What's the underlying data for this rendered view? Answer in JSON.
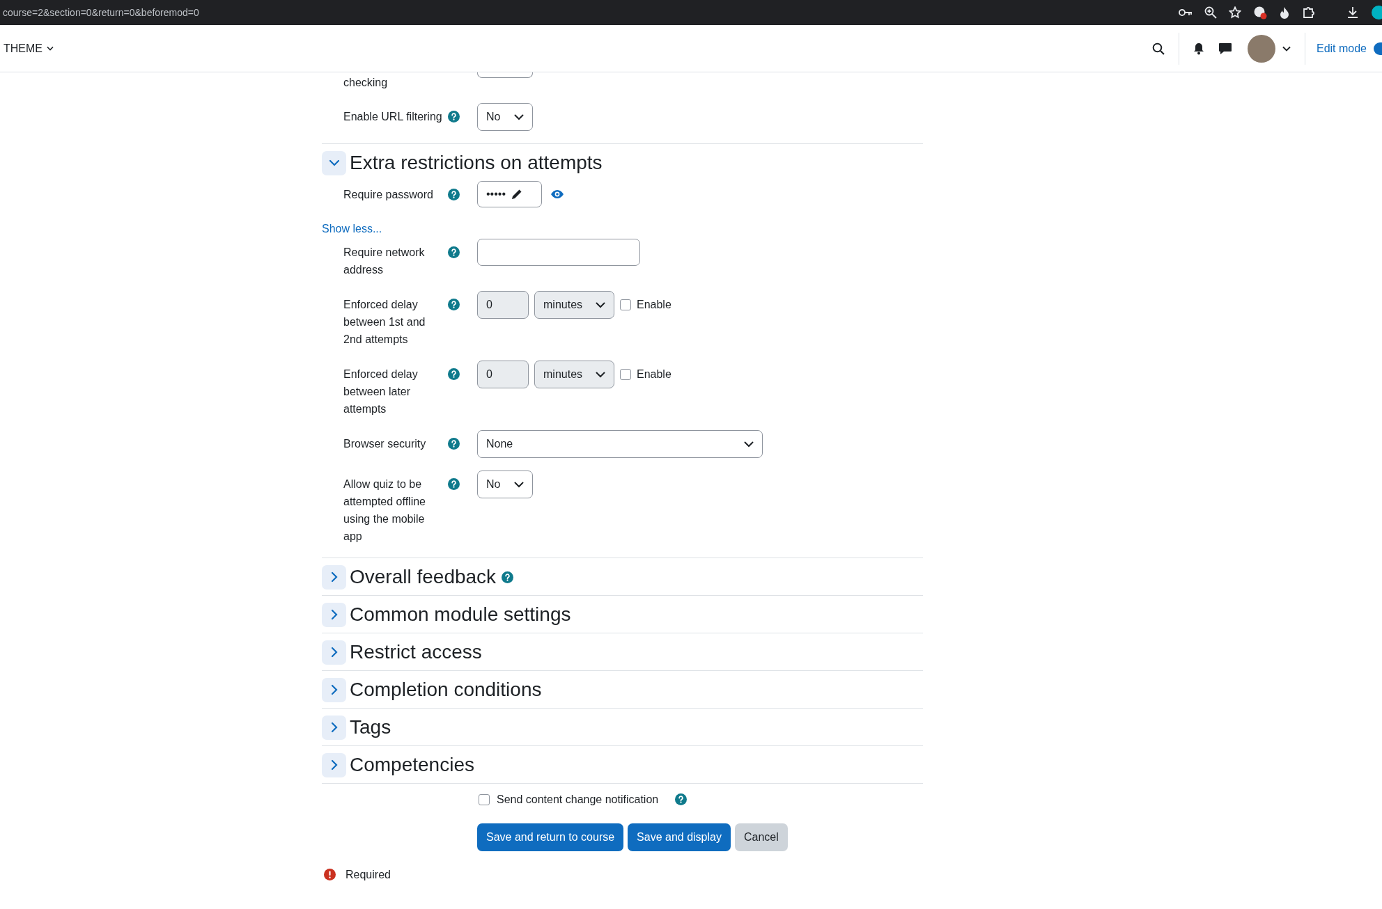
{
  "browser": {
    "url": "course=2&section=0&return=0&beforemod=0"
  },
  "navbar": {
    "menu": "THEME",
    "edit_mode": {
      "label": "Edit mode",
      "on": true
    }
  },
  "form": {
    "rows": [
      {
        "kind": "cut_select",
        "label": "checking"
      },
      {
        "kind": "select",
        "label": "Enable URL filtering",
        "help": true,
        "value": "No"
      }
    ],
    "sections": [
      {
        "title": "Extra restrictions on attempts",
        "expanded": true,
        "rows": [
          {
            "kind": "password",
            "label": "Require password",
            "help": true,
            "value": "•••••"
          }
        ],
        "more_link": "Show less...",
        "more_rows": [
          {
            "kind": "text",
            "label": "Require network address",
            "help": true
          },
          {
            "kind": "delay",
            "label": "Enforced delay between 1st and 2nd attempts",
            "help": true,
            "value": "0",
            "unit": "minutes",
            "disabled": true,
            "checkbox": {
              "label": "Enable",
              "checked": false
            }
          },
          {
            "kind": "delay",
            "label": "Enforced delay between later attempts",
            "help": true,
            "value": "0",
            "unit": "minutes",
            "disabled": true,
            "checkbox": {
              "label": "Enable",
              "checked": false
            }
          },
          {
            "kind": "wide_select",
            "label": "Browser security",
            "help": true,
            "value": "None"
          },
          {
            "kind": "select",
            "label": "Allow quiz to be attempted offline using the mobile app",
            "help": true,
            "value": "No"
          }
        ]
      },
      {
        "title": "Overall feedback",
        "expanded": false,
        "help": true
      },
      {
        "title": "Common module settings",
        "expanded": false
      },
      {
        "title": "Restrict access",
        "expanded": false
      },
      {
        "title": "Completion conditions",
        "expanded": false
      },
      {
        "title": "Tags",
        "expanded": false
      },
      {
        "title": "Competencies",
        "expanded": false
      }
    ],
    "notification": {
      "label": "Send content change notification",
      "checked": false,
      "help": true
    },
    "buttons": [
      {
        "label": "Save and return to course",
        "kind": "primary"
      },
      {
        "label": "Save and display",
        "kind": "primary"
      },
      {
        "label": "Cancel",
        "kind": "secondary"
      }
    ],
    "required_note": "Required"
  }
}
